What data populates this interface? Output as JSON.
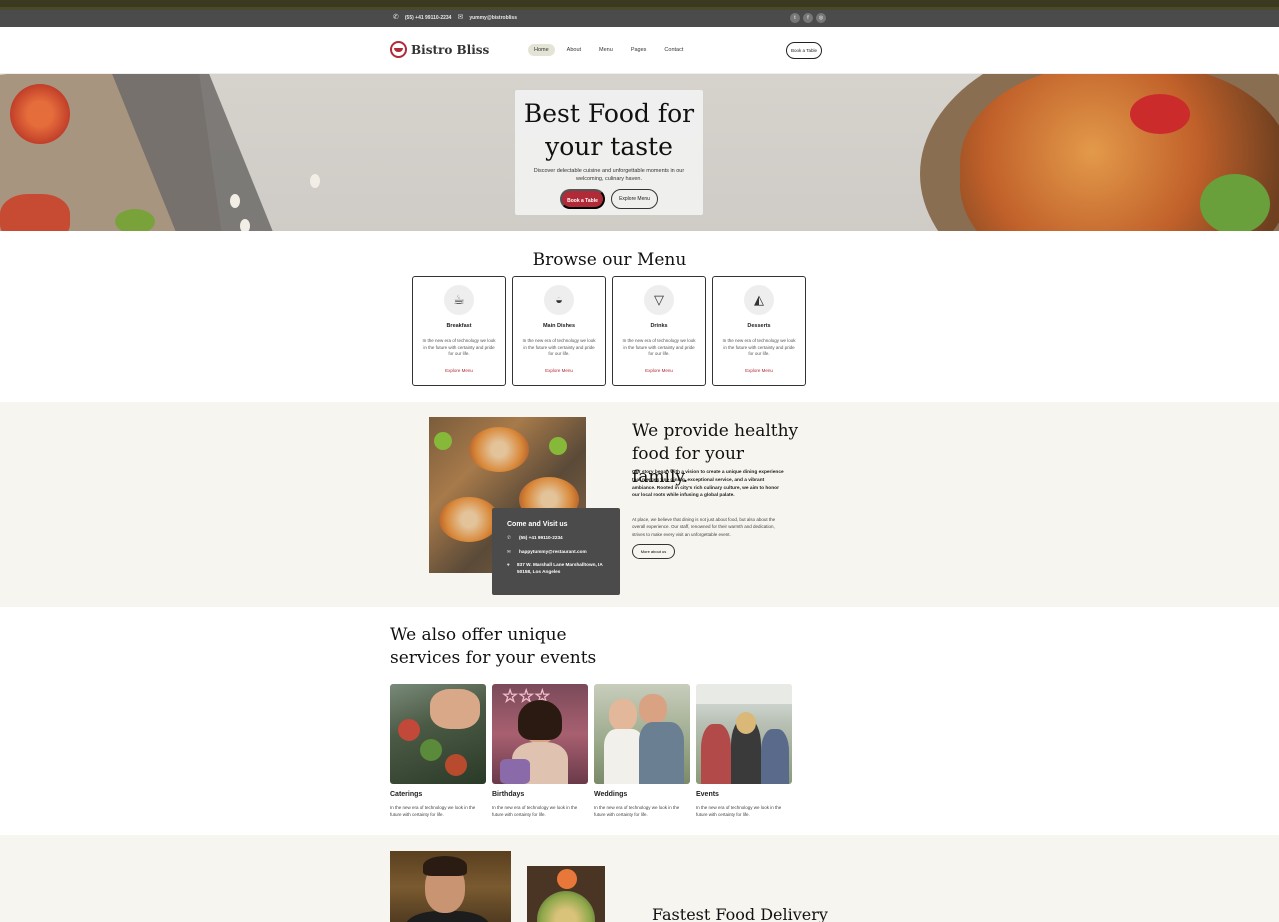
{
  "topbar": {
    "phone": "(55) +41 99110-2234",
    "email": "yummy@bistrobliss",
    "social": [
      "twitter",
      "facebook",
      "instagram"
    ]
  },
  "nav": {
    "brand": "Bistro Bliss",
    "items": [
      {
        "label": "Home",
        "active": true
      },
      {
        "label": "About"
      },
      {
        "label": "Menu"
      },
      {
        "label": "Pages"
      },
      {
        "label": "Contact"
      }
    ],
    "cta": "Book a Table"
  },
  "hero": {
    "title": "Best Food for your taste",
    "subtitle": "Discover delectable cuisine and unforgettable moments in our welcoming, culinary haven.",
    "primary_button": "Book a Table",
    "secondary_button": "Explore Menu"
  },
  "browse": {
    "title": "Browse our Menu",
    "cards": [
      {
        "icon": "coffee-cup-icon",
        "title": "Breakfast",
        "desc": "In the new era of technology we look in the future with certainty and pride for our life.",
        "link": "Explore Menu"
      },
      {
        "icon": "bowl-icon",
        "title": "Main Dishes",
        "desc": "In the new era of technology we look in the future with certainty and pride for our life.",
        "link": "Explore Menu"
      },
      {
        "icon": "drink-icon",
        "title": "Drinks",
        "desc": "In the new era of technology we look in the future with certainty and pride for our life.",
        "link": "Explore Menu"
      },
      {
        "icon": "cake-icon",
        "title": "Desserts",
        "desc": "In the new era of technology we look in the future with certainty and pride for our life.",
        "link": "Explore Menu"
      }
    ]
  },
  "about": {
    "title": "We provide healthy food for your family.",
    "p1": "Our story began with a vision to create a unique dining experience that merges fine dining, exceptional service, and a vibrant ambiance. Rooted in city's rich culinary culture, we aim to honor our local roots while infusing a global palate.",
    "p2": "At place, we believe that dining is not just about food, but also about the overall experience. Our staff, renowned for their warmth and dedication, strives to make every visit an unforgettable event.",
    "button": "More about us",
    "visit": {
      "title": "Come and Visit us",
      "phone": "(55) +41 99110-2234",
      "email": "happytummy@restaurant.com",
      "address": "837 W. Marshall Lane Marshalltown, IA 50158, Los Angeles"
    }
  },
  "services": {
    "title": "We also offer unique services for your events",
    "items": [
      {
        "title": "Caterings",
        "desc": "In the new era of technology we look in the future with certainty for life."
      },
      {
        "title": "Birthdays",
        "desc": "In the new era of technology we look in the future with certainty for life."
      },
      {
        "title": "Weddings",
        "desc": "In the new era of technology we look in the future with certainty for life."
      },
      {
        "title": "Events",
        "desc": "In the new era of technology we look in the future with certainty for life."
      }
    ]
  },
  "delivery": {
    "title": "Fastest Food Delivery"
  }
}
